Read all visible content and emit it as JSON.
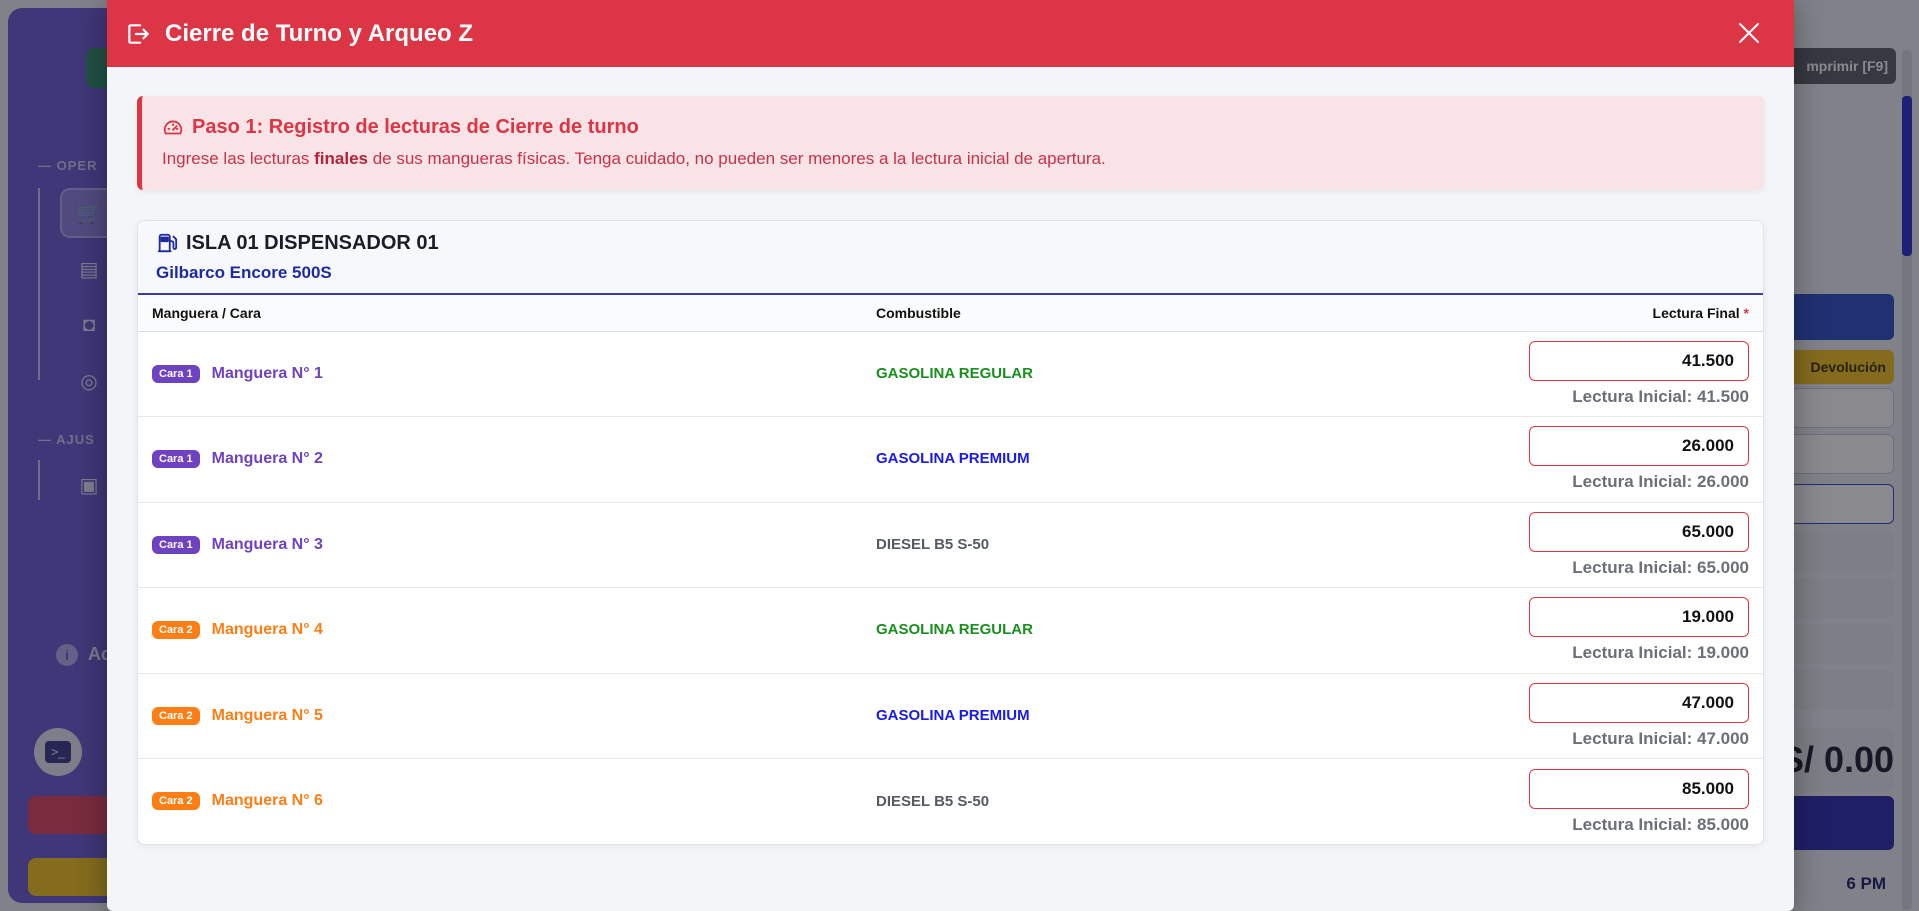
{
  "background": {
    "sidebar": {
      "section_operations": "OPER",
      "section_settings": "AJUS",
      "info_label": "Ac"
    },
    "right_panel": {
      "print_label": "mprimir [F9]",
      "return_label": "Devolución",
      "total": "S/ 0.00",
      "time": "6 PM"
    }
  },
  "modal": {
    "title": "Cierre de Turno y Arqueo Z",
    "colors": {
      "header": "#dc3545",
      "accent": "#3a39a8"
    },
    "alert": {
      "title": "Paso 1: Registro de lecturas de Cierre de turno",
      "desc_before": "Ingrese las lecturas ",
      "desc_bold": "finales",
      "desc_after": " de sus mangueras físicas. Tenga cuidado, no pueden ser menores a la lectura inicial de apertura."
    },
    "dispenser": {
      "name": "ISLA 01 DISPENSADOR 01",
      "model": "Gilbarco Encore 500S"
    },
    "table": {
      "headers": {
        "hose": "Manguera / Cara",
        "fuel": "Combustible",
        "final": "Lectura Final",
        "required_mark": "*"
      },
      "rows": [
        {
          "face": "Cara 1",
          "hose": "Manguera N° 1",
          "fuel": "GASOLINA REGULAR",
          "final_value": "41.500",
          "initial": "Lectura Inicial: 41.500"
        },
        {
          "face": "Cara 1",
          "hose": "Manguera N° 2",
          "fuel": "GASOLINA PREMIUM",
          "final_value": "26.000",
          "initial": "Lectura Inicial: 26.000"
        },
        {
          "face": "Cara 1",
          "hose": "Manguera N° 3",
          "fuel": "DIESEL B5 S-50",
          "final_value": "65.000",
          "initial": "Lectura Inicial: 65.000"
        },
        {
          "face": "Cara 2",
          "hose": "Manguera N° 4",
          "fuel": "GASOLINA REGULAR",
          "final_value": "19.000",
          "initial": "Lectura Inicial: 19.000"
        },
        {
          "face": "Cara 2",
          "hose": "Manguera N° 5",
          "fuel": "GASOLINA PREMIUM",
          "final_value": "47.000",
          "initial": "Lectura Inicial: 47.000"
        },
        {
          "face": "Cara 2",
          "hose": "Manguera N° 6",
          "fuel": "DIESEL B5 S-50",
          "final_value": "85.000",
          "initial": "Lectura Inicial: 85.000"
        }
      ]
    }
  }
}
